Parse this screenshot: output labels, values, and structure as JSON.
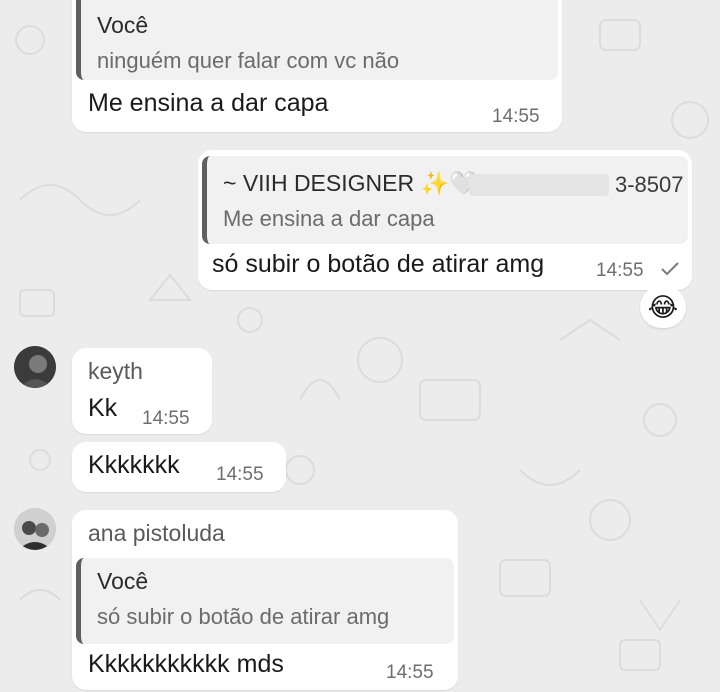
{
  "messages": [
    {
      "quote_author": "Você",
      "quote_text": "ninguém quer falar com vc não",
      "text": "Me ensina a dar capa",
      "time": "14:55"
    },
    {
      "quote_author": "~ VIIH DESIGNER ✨🤍",
      "quote_phone_suffix": "3-8507",
      "quote_text": "Me ensina a dar capa",
      "text": "só subir o botão de atirar amg",
      "time": "14:55",
      "status_icon": "single-check-icon",
      "reaction_emoji": "😂"
    },
    {
      "sender": "keyth",
      "text": "Kk",
      "time": "14:55"
    },
    {
      "text": "Kkkkkkk",
      "time": "14:55"
    },
    {
      "sender": "ana pistoluda",
      "quote_author": "Você",
      "quote_text": "só subir o botão de atirar amg",
      "text": "Kkkkkkkkkkk mds",
      "time": "14:55"
    }
  ],
  "colors": {
    "background": "#ececec",
    "bubble": "#ffffff",
    "quote_bar": "#5f5f5f"
  }
}
